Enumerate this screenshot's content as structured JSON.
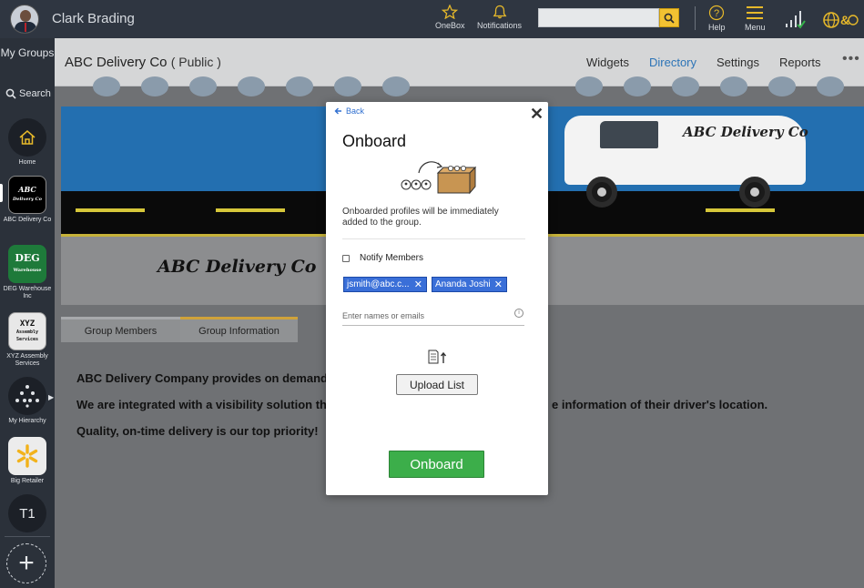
{
  "topbar": {
    "username": "Clark Brading",
    "onebox_label": "OneBox",
    "notifications_label": "Notifications",
    "search_placeholder": "",
    "help_label": "Help",
    "menu_label": "Menu",
    "accent_color": "#f2c232"
  },
  "sidebar": {
    "my_groups": "My Groups",
    "search_label": "Search",
    "items": [
      {
        "label": "Home",
        "icon": "home-icon"
      },
      {
        "label": "ABC Delivery Co",
        "logo_text": "ABC Delivery Co"
      },
      {
        "label": "DEG Warehouse Inc",
        "logo_text": "DEG",
        "logo_sub": "Warehouse"
      },
      {
        "label": "XYZ Assembly Services",
        "logo_text": "XYZ",
        "logo_sub": "Assembly Services"
      },
      {
        "label": "My Hierarchy",
        "icon": "hierarchy-icon"
      },
      {
        "label": "Big Retailer",
        "icon": "spark-icon"
      },
      {
        "label": "T1",
        "logo_text": "T1"
      }
    ]
  },
  "group": {
    "name": "ABC Delivery Co",
    "visibility": "( Public )",
    "nav": [
      "Widgets",
      "Directory",
      "Settings",
      "Reports"
    ],
    "active_nav": "Directory",
    "more": "•••",
    "banner_name": "ABC Delivery Co",
    "van_text": "ABC Delivery Co",
    "tabs": [
      "Group Members",
      "Group Information"
    ],
    "active_tab": "Group Information",
    "info_lines": [
      "ABC Delivery Company provides on demand c",
      "We are integrated with a visibility solution tha",
      "Quality, on-time delivery is our top priority!"
    ],
    "info_tail": "e information of their driver's location."
  },
  "modal": {
    "back": "Back",
    "title": "Onboard",
    "description": "Onboarded profiles will be immediately added to the group.",
    "notify_label": "Notify Members",
    "notify_checked": false,
    "chips": [
      "jsmith@abc.c...",
      "Ananda Joshi"
    ],
    "input_placeholder": "Enter names or emails",
    "upload_label": "Upload List",
    "onboard_label": "Onboard",
    "onboard_color": "#3cae4a",
    "chip_color": "#3a6fd8"
  }
}
